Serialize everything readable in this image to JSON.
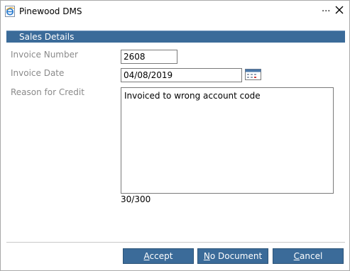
{
  "window": {
    "title": "Pinewood DMS",
    "more_label": "...",
    "app_icon": "ie-e-icon",
    "close_icon": "close-x-icon"
  },
  "section": {
    "title": "Sales Details"
  },
  "form": {
    "invoice_number": {
      "label": "Invoice Number",
      "value": "2608"
    },
    "invoice_date": {
      "label": "Invoice Date",
      "value": "04/08/2019",
      "picker_icon": "calendar-icon"
    },
    "reason": {
      "label": "Reason for Credit",
      "value": "Invoiced to wrong account code",
      "counter": "30/300"
    }
  },
  "buttons": {
    "accept": {
      "accel": "A",
      "rest": "ccept"
    },
    "no_document": {
      "accel": "N",
      "rest": "o Document"
    },
    "cancel": {
      "accel": "C",
      "rest": "ancel"
    }
  },
  "colors": {
    "header_bg": "#3b6b99",
    "button_bg": "#3b6b99",
    "label_text": "#8a8a8a"
  }
}
